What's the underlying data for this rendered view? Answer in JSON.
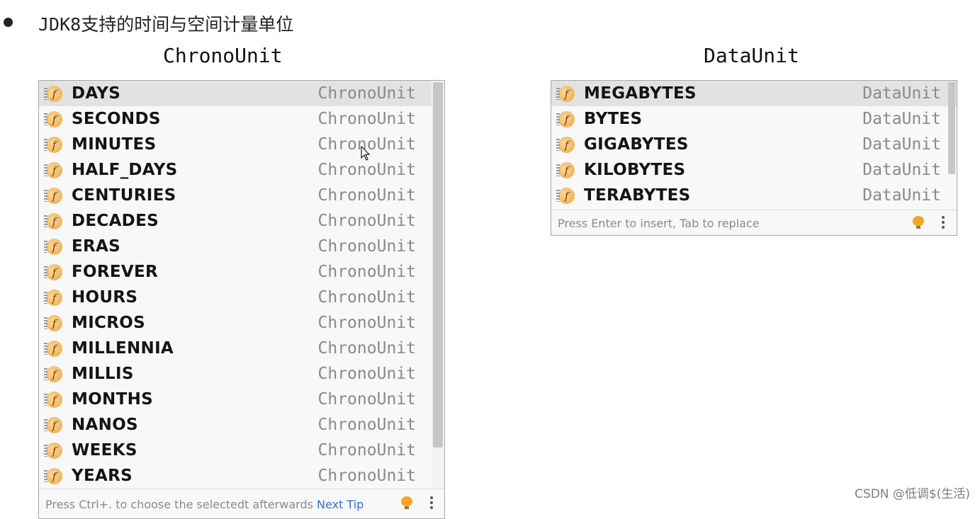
{
  "heading": "JDK8支持的时间与空间计量单位",
  "chrono_panel": {
    "title": "ChronoUnit",
    "items": [
      {
        "name": "DAYS",
        "type": "ChronoUnit"
      },
      {
        "name": "SECONDS",
        "type": "ChronoUnit"
      },
      {
        "name": "MINUTES",
        "type": "ChronoUnit"
      },
      {
        "name": "HALF_DAYS",
        "type": "ChronoUnit"
      },
      {
        "name": "CENTURIES",
        "type": "ChronoUnit"
      },
      {
        "name": "DECADES",
        "type": "ChronoUnit"
      },
      {
        "name": "ERAS",
        "type": "ChronoUnit"
      },
      {
        "name": "FOREVER",
        "type": "ChronoUnit"
      },
      {
        "name": "HOURS",
        "type": "ChronoUnit"
      },
      {
        "name": "MICROS",
        "type": "ChronoUnit"
      },
      {
        "name": "MILLENNIA",
        "type": "ChronoUnit"
      },
      {
        "name": "MILLIS",
        "type": "ChronoUnit"
      },
      {
        "name": "MONTHS",
        "type": "ChronoUnit"
      },
      {
        "name": "NANOS",
        "type": "ChronoUnit"
      },
      {
        "name": "WEEKS",
        "type": "ChronoUnit"
      },
      {
        "name": "YEARS",
        "type": "ChronoUnit"
      }
    ],
    "footer_text": "Press Ctrl+. to choose the selectedt afterwards",
    "footer_link": "Next Tip"
  },
  "data_panel": {
    "title": "DataUnit",
    "items": [
      {
        "name": "MEGABYTES",
        "type": "DataUnit"
      },
      {
        "name": "BYTES",
        "type": "DataUnit"
      },
      {
        "name": "GIGABYTES",
        "type": "DataUnit"
      },
      {
        "name": "KILOBYTES",
        "type": "DataUnit"
      },
      {
        "name": "TERABYTES",
        "type": "DataUnit"
      }
    ],
    "footer_text": "Press Enter to insert, Tab to replace"
  },
  "icons": {
    "item": "field-icon",
    "tip": "lightbulb-icon",
    "menu": "more-options-icon",
    "pointer": "mouse-cursor-icon"
  },
  "colors": {
    "selected_row": "#e2e2e2",
    "icon_orange": "#f2b45a",
    "link": "#3a6fc4",
    "type_text": "#8a8a8a"
  },
  "watermark": "CSDN @低调$(生活)"
}
